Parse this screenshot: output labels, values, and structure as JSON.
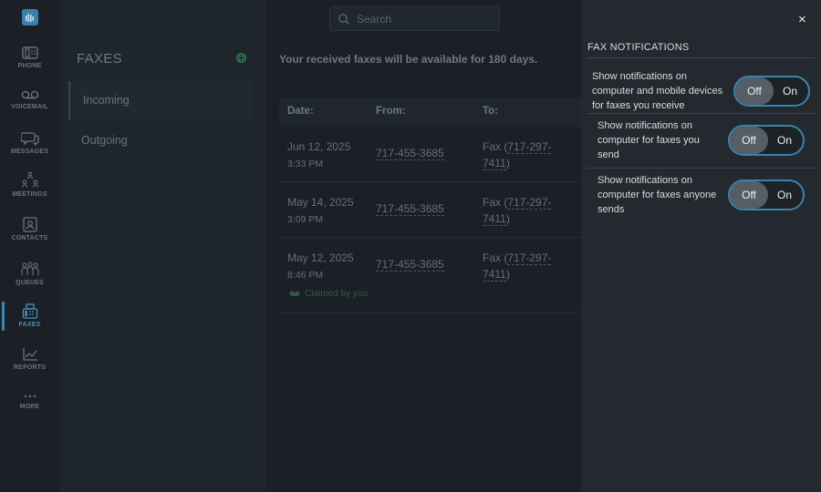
{
  "sidebar": {
    "items": [
      {
        "label": "PHONE",
        "icon": "phone-icon"
      },
      {
        "label": "VOICEMAIL",
        "icon": "voicemail-icon"
      },
      {
        "label": "MESSAGES",
        "icon": "messages-icon"
      },
      {
        "label": "MEETINGS",
        "icon": "meetings-icon"
      },
      {
        "label": "CONTACTS",
        "icon": "contacts-icon"
      },
      {
        "label": "QUEUES",
        "icon": "queues-icon"
      },
      {
        "label": "FAXES",
        "icon": "fax-icon"
      },
      {
        "label": "REPORTS",
        "icon": "reports-icon"
      },
      {
        "label": "MORE",
        "icon": "more-icon"
      }
    ],
    "active": "FAXES"
  },
  "list": {
    "title": "FAXES",
    "items": [
      "Incoming",
      "Outgoing"
    ],
    "selected": "Incoming"
  },
  "search": {
    "placeholder": "Search"
  },
  "main": {
    "notice": "Your received faxes will be available for 180 days.",
    "columns": [
      "Date:",
      "From:",
      "To:"
    ],
    "rows": [
      {
        "date": "Jun 12, 2025",
        "time": "3:33 PM",
        "from": "717-455-3685",
        "to_prefix": "Fax (",
        "to_line1": "717-297-",
        "to_line2": "7411",
        "to_suffix": ")"
      },
      {
        "date": "May 14, 2025",
        "time": "3:09 PM",
        "from": "717-455-3685",
        "to_prefix": "Fax (",
        "to_line1": "717-297-",
        "to_line2": "7411",
        "to_suffix": ")"
      },
      {
        "date": "May 12, 2025",
        "time": "8:46 PM",
        "from": "717-455-3685",
        "to_prefix": "Fax (",
        "to_line1": "717-297-",
        "to_line2": "7411",
        "to_suffix": ")",
        "claimed": "Claimed by you"
      }
    ]
  },
  "drawer": {
    "title": "FAX NOTIFICATIONS",
    "close_label": "×",
    "options": [
      {
        "text": "Show notifications on computer and mobile devices for faxes you receive",
        "off": "Off",
        "on": "On",
        "state": "Off"
      },
      {
        "text": "Show notifications on computer for faxes you send",
        "off": "Off",
        "on": "On",
        "state": "Off"
      },
      {
        "text": "Show notifications on computer for faxes anyone sends",
        "off": "Off",
        "on": "On",
        "state": "Off"
      }
    ]
  },
  "colors": {
    "accent": "#3c82ad",
    "drawer_bg": "#23292e",
    "background": "#1b2026"
  }
}
